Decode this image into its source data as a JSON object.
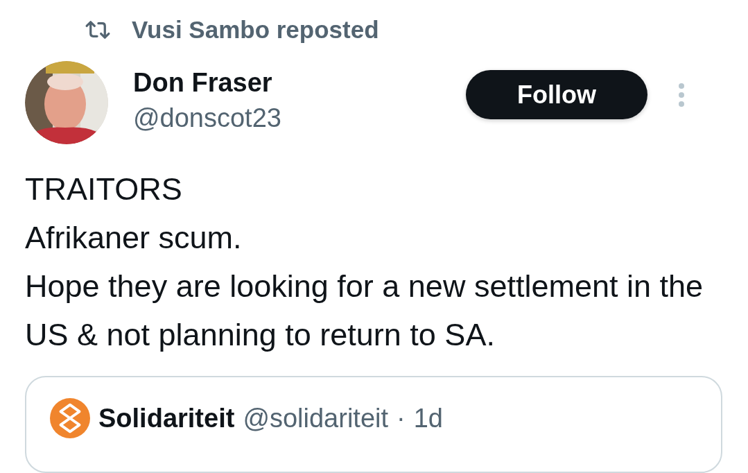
{
  "repost": {
    "label": "Vusi Sambo reposted"
  },
  "author": {
    "name": "Don Fraser",
    "handle": "@donscot23"
  },
  "follow_button": {
    "label": "Follow"
  },
  "text": "TRAITORS\nAfrikaner scum.\nHope they are looking for a new settlement in the US & not planning to return to SA.",
  "quoted_post": {
    "name": "Solidariteit",
    "handle": "@solidariteit",
    "separator": "·",
    "time": "1d"
  }
}
